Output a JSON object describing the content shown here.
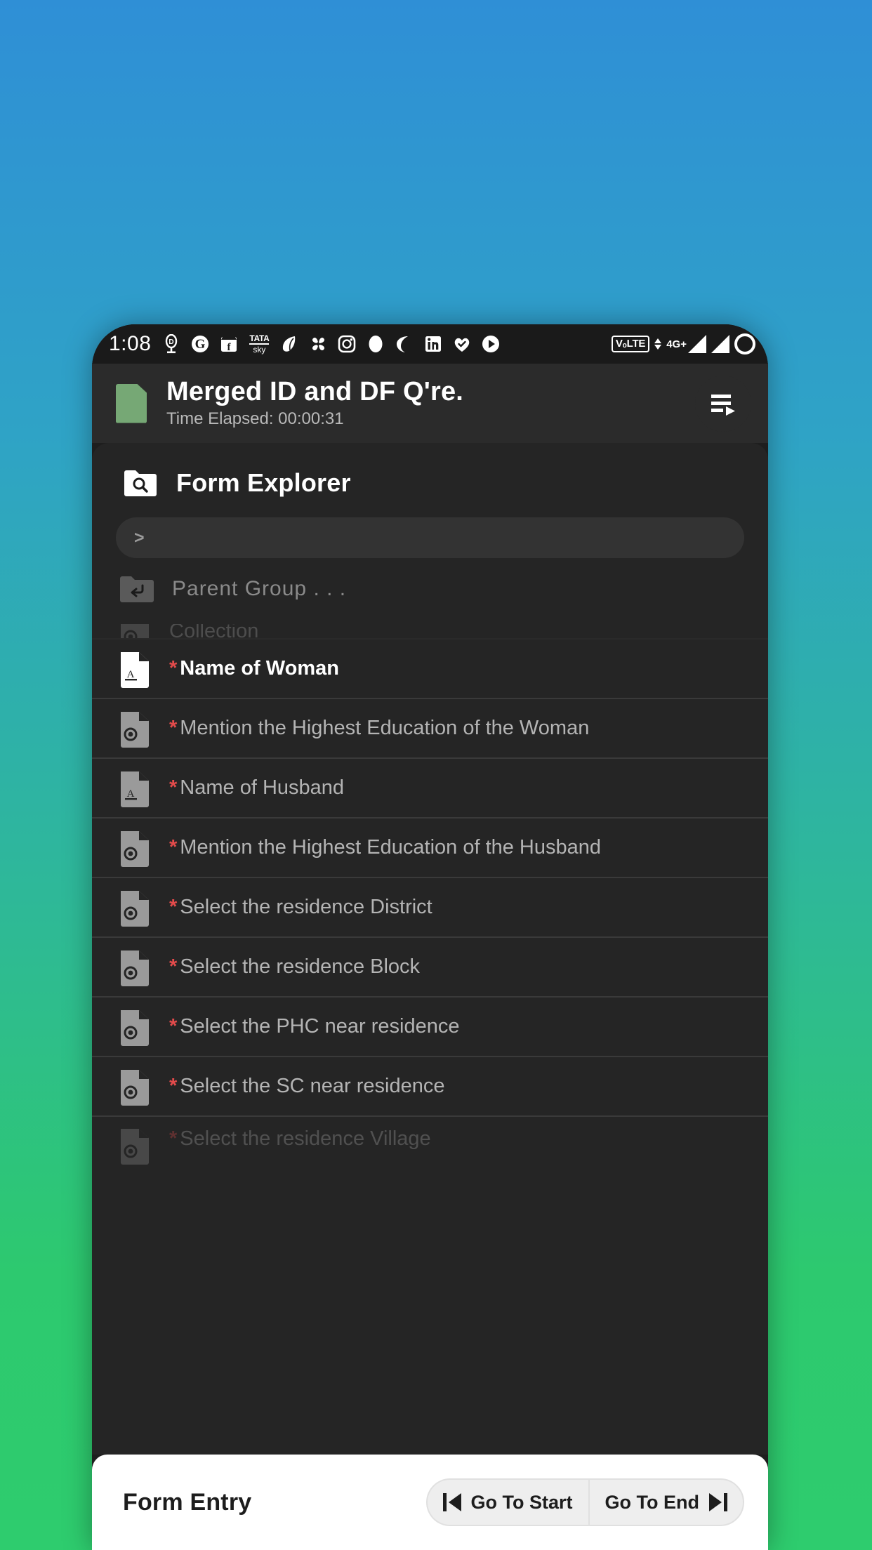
{
  "status_bar": {
    "clock": "1:08",
    "left_icons": [
      {
        "name": "dailyhunt-icon",
        "glyph": "D"
      },
      {
        "name": "google-icon",
        "glyph": "G"
      },
      {
        "name": "facebook-marketplace-icon",
        "glyph": "f"
      },
      {
        "name": "tata-sky-icon",
        "line1": "TATA",
        "line2": "sky"
      },
      {
        "name": "leaf-icon",
        "glyph": ""
      },
      {
        "name": "pinwheel-icon",
        "glyph": ""
      },
      {
        "name": "instagram-icon",
        "glyph": ""
      },
      {
        "name": "oval-icon",
        "glyph": ""
      },
      {
        "name": "moon-icon",
        "glyph": ""
      },
      {
        "name": "linkedin-icon",
        "glyph": "in"
      },
      {
        "name": "heart-check-icon",
        "glyph": ""
      },
      {
        "name": "play-icon",
        "glyph": ""
      }
    ],
    "right_icons": [
      {
        "name": "volte-icon",
        "label": "VₒLTE"
      },
      {
        "name": "mobile-data-icon",
        "label": "4G+"
      },
      {
        "name": "signal-strength-icon",
        "label": ""
      },
      {
        "name": "signal-strength-2-icon",
        "label": ""
      },
      {
        "name": "battery-icon",
        "label": ""
      }
    ]
  },
  "header": {
    "title": "Merged ID and DF Q're.",
    "subtitle": "Time Elapsed: 00:00:31",
    "doc_icon_color": "#76a875",
    "menu_icon": "playlist-play-icon"
  },
  "explorer": {
    "title": "Form Explorer",
    "folder_icon": "folder-search-icon",
    "path_value": ">",
    "path_placeholder": ">",
    "parent_group_label": "Parent Group . . .",
    "parent_group_icon": "folder-up-icon"
  },
  "list": {
    "partial_top_label": "Collection",
    "items": [
      {
        "label": "Name of Woman",
        "required": true,
        "icon": "text-field-icon",
        "active": true
      },
      {
        "label": "Mention the Highest Education of the Woman",
        "required": true,
        "icon": "select-field-icon",
        "active": false
      },
      {
        "label": "Name of Husband",
        "required": true,
        "icon": "text-field-icon",
        "active": false
      },
      {
        "label": "Mention the Highest Education of the Husband",
        "required": true,
        "icon": "select-field-icon",
        "active": false
      },
      {
        "label": "Select the residence District",
        "required": true,
        "icon": "select-field-icon",
        "active": false
      },
      {
        "label": "Select the residence Block",
        "required": true,
        "icon": "select-field-icon",
        "active": false
      },
      {
        "label": "Select the PHC near residence",
        "required": true,
        "icon": "select-field-icon",
        "active": false
      },
      {
        "label": "Select the SC near residence",
        "required": true,
        "icon": "select-field-icon",
        "active": false
      }
    ],
    "partial_bottom_label": "Select the residence Village",
    "required_marker": "*",
    "required_color": "#e34b4b"
  },
  "form_entry": {
    "title": "Form Entry",
    "go_to_start_label": "Go To Start",
    "go_to_end_label": "Go To End"
  },
  "theme": {
    "wallpaper_top": "#2f8fd6",
    "wallpaper_bottom": "#2ecc6e",
    "panel_bg": "#252525",
    "header_bg": "#2b2b2b",
    "screen_bg": "#1e1e1e"
  }
}
